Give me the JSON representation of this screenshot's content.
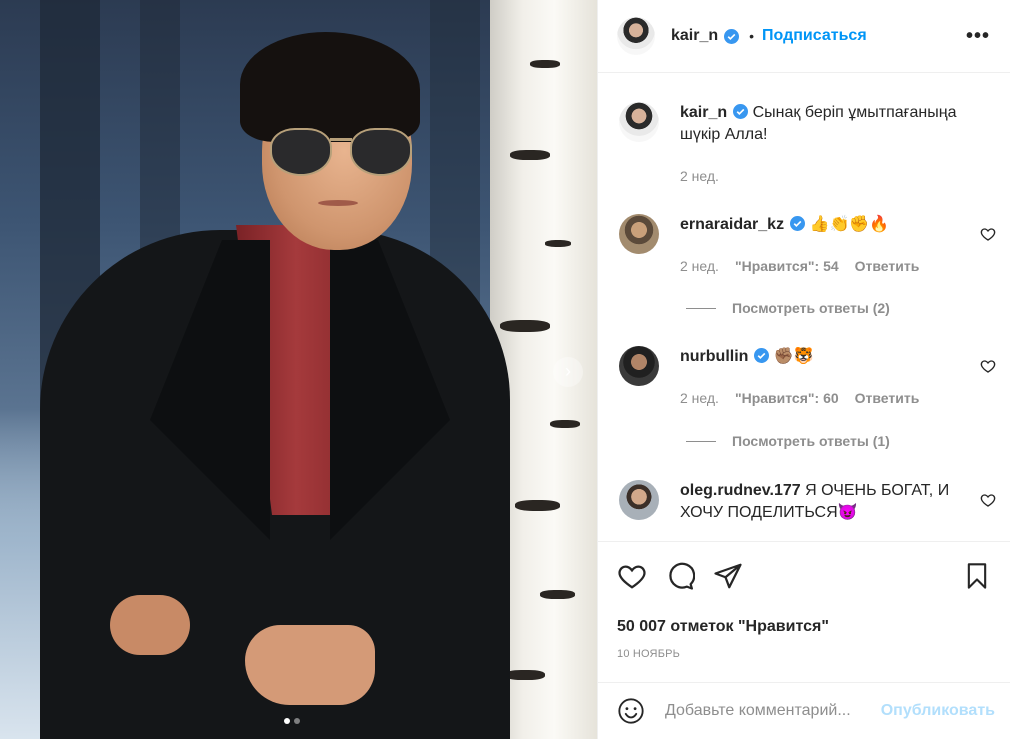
{
  "post": {
    "author": "kair_n",
    "dot": "•",
    "follow_label": "Подписаться",
    "more_label": "•••",
    "caption": "Сынақ беріп ұмытпағаныңа шүкір Алла!",
    "caption_time": "2 нед."
  },
  "comments": [
    {
      "user": "ernaraidar_kz",
      "text": "👍👏✊🔥",
      "time": "2 нед.",
      "likes": "\"Нравится\": 54",
      "reply": "Ответить",
      "view_replies": "Посмотреть ответы (2)"
    },
    {
      "user": "nurbullin",
      "text": "✊🏽🐯",
      "time": "2 нед.",
      "likes": "\"Нравится\": 60",
      "reply": "Ответить",
      "view_replies": "Посмотреть ответы (1)"
    },
    {
      "user": "oleg.rudnev.177",
      "text": "Я ОЧЕНЬ БОГАТ, И ХОЧУ ПОДЕЛИТЬСЯ😈"
    }
  ],
  "likes_count": "50 007 отметок \"Нравится\"",
  "date": "10 НОЯБРЬ",
  "add_comment": {
    "placeholder": "Добавьте комментарий...",
    "post_label": "Опубликовать"
  },
  "carousel": {
    "slides": 2,
    "active": 1
  },
  "colors": {
    "link_blue": "#0095f6",
    "disabled_blue": "#b2dffc",
    "muted": "#8e8e8e"
  }
}
